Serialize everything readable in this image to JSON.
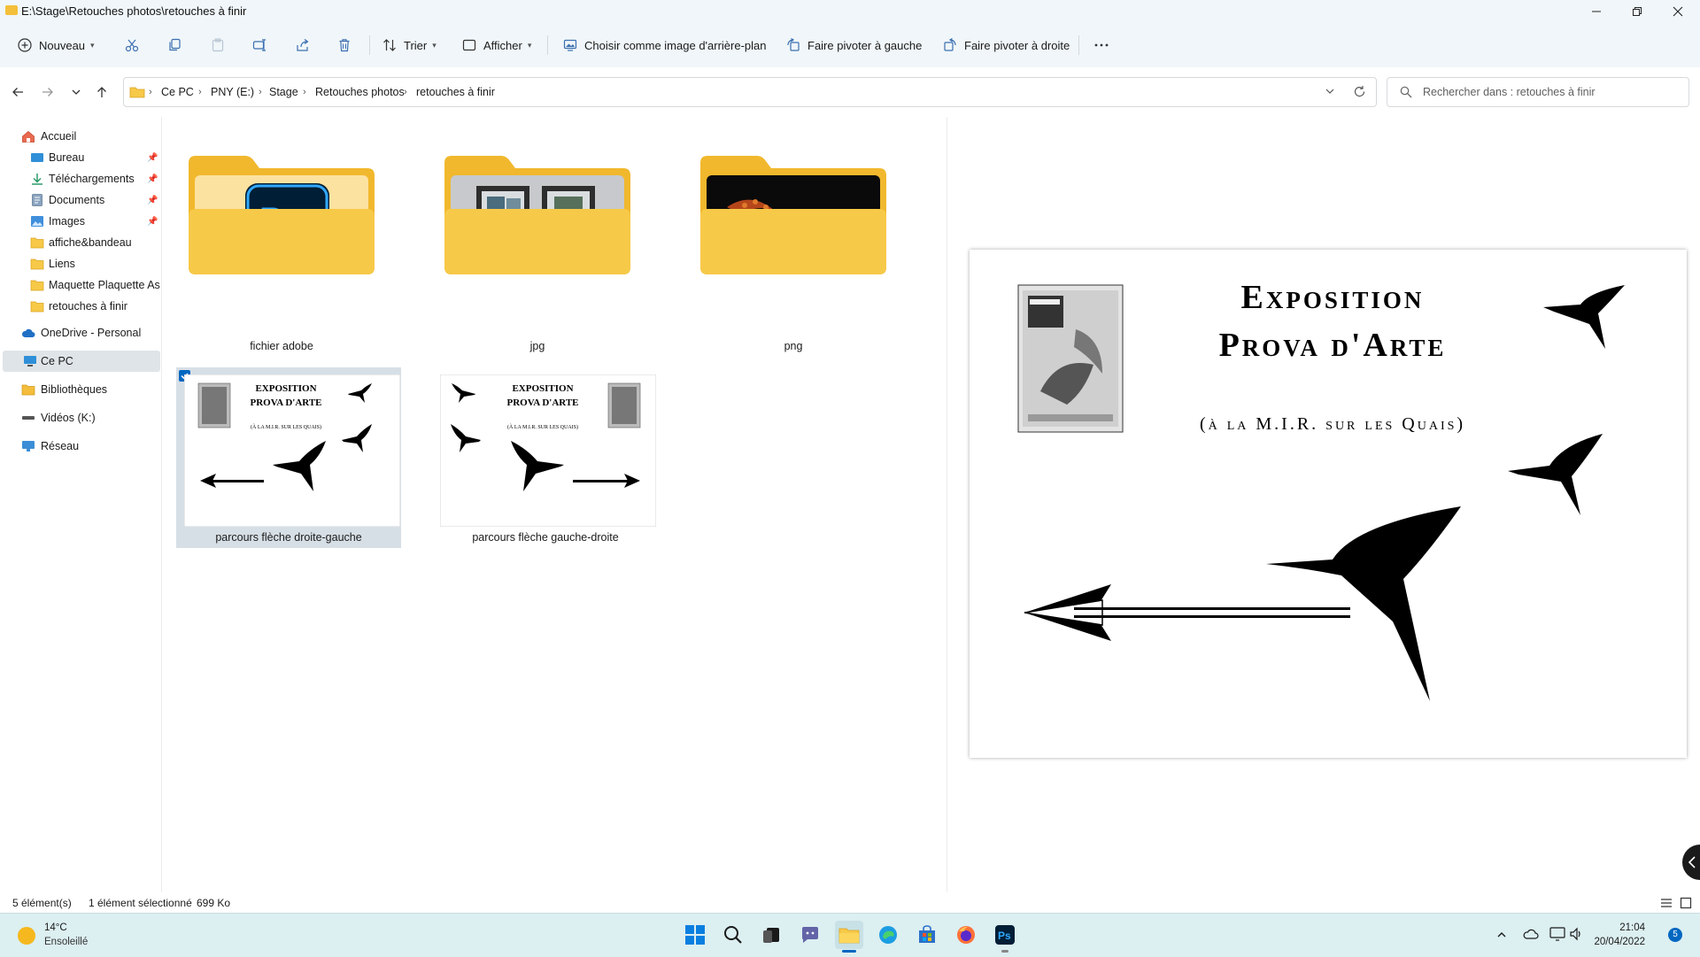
{
  "window": {
    "path_title": "E:\\Stage\\Retouches photos\\retouches à finir"
  },
  "toolbar": {
    "new_label": "Nouveau",
    "sort_label": "Trier",
    "view_label": "Afficher",
    "set_background_label": "Choisir comme image d'arrière-plan",
    "rotate_left_label": "Faire pivoter à gauche",
    "rotate_right_label": "Faire pivoter à droite"
  },
  "breadcrumb": [
    "Ce PC",
    "PNY (E:)",
    "Stage",
    "Retouches photos",
    "retouches à finir"
  ],
  "search": {
    "placeholder": "Rechercher dans : retouches à finir"
  },
  "sidebar": {
    "items": [
      {
        "label": "Accueil",
        "icon": "home-icon"
      },
      {
        "label": "Bureau",
        "icon": "desktop-icon",
        "pinned": true
      },
      {
        "label": "Téléchargements",
        "icon": "download-icon",
        "pinned": true
      },
      {
        "label": "Documents",
        "icon": "document-icon",
        "pinned": true
      },
      {
        "label": "Images",
        "icon": "image-icon",
        "pinned": true
      },
      {
        "label": "affiche&bandeau",
        "icon": "folder-icon"
      },
      {
        "label": "Liens",
        "icon": "folder-icon"
      },
      {
        "label": "Maquette Plaquette Ass",
        "icon": "folder-icon"
      },
      {
        "label": "retouches à finir",
        "icon": "folder-icon"
      },
      {
        "label": "OneDrive - Personal",
        "icon": "cloud-icon"
      },
      {
        "label": "Ce PC",
        "icon": "pc-icon",
        "selected": true
      },
      {
        "label": "Bibliothèques",
        "icon": "library-icon"
      },
      {
        "label": "Vidéos (K:)",
        "icon": "drive-icon"
      },
      {
        "label": "Réseau",
        "icon": "network-icon"
      }
    ]
  },
  "files": [
    {
      "name": "fichier adobe",
      "type": "folder",
      "preview": "photoshop-logo"
    },
    {
      "name": "jpg",
      "type": "folder",
      "preview": "wall-frames"
    },
    {
      "name": "png",
      "type": "folder",
      "preview": "dark-image"
    },
    {
      "name": "parcours flèche droite-gauche",
      "type": "image",
      "selected": true
    },
    {
      "name": "parcours flèche gauche-droite",
      "type": "image",
      "selected": false
    }
  ],
  "poster": {
    "title_line1": "Exposition",
    "title_line2": "Prova d'Arte",
    "subtitle": "(à la M.I.R. sur les Quais)"
  },
  "status": {
    "count": "5 élément(s)",
    "selection": "1 élément sélectionné",
    "size": "699 Ko"
  },
  "weather": {
    "temp": "14°C",
    "condition": "Ensoleillé"
  },
  "clock": {
    "time": "21:04",
    "date": "20/04/2022"
  },
  "notification_count": "5",
  "colors": {
    "folder_yellow": "#f7c948",
    "folder_back": "#f1b82d",
    "selection_bg": "#dfe4e8",
    "taskbar_bg": "#dceff1",
    "accent": "#0067c0"
  }
}
